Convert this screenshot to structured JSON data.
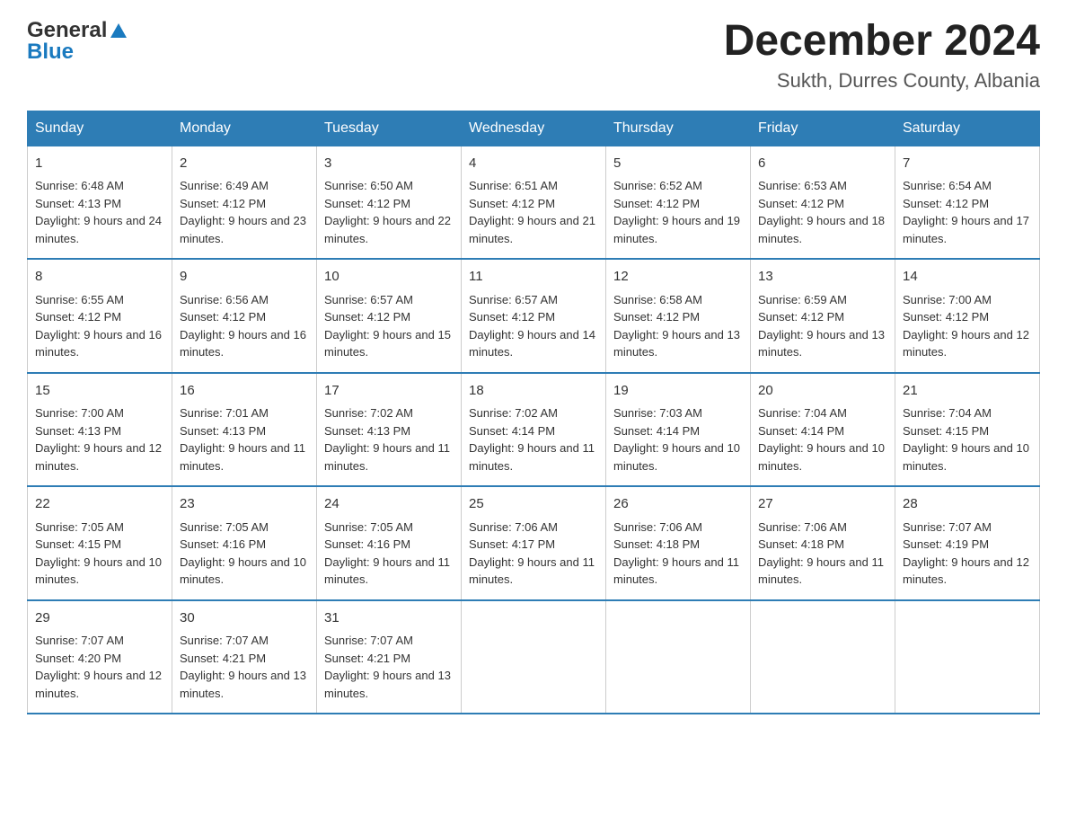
{
  "header": {
    "logo_general": "General",
    "logo_blue": "Blue",
    "month_title": "December 2024",
    "location": "Sukth, Durres County, Albania"
  },
  "weekdays": [
    "Sunday",
    "Monday",
    "Tuesday",
    "Wednesday",
    "Thursday",
    "Friday",
    "Saturday"
  ],
  "weeks": [
    [
      {
        "day": "1",
        "sunrise": "Sunrise: 6:48 AM",
        "sunset": "Sunset: 4:13 PM",
        "daylight": "Daylight: 9 hours and 24 minutes."
      },
      {
        "day": "2",
        "sunrise": "Sunrise: 6:49 AM",
        "sunset": "Sunset: 4:12 PM",
        "daylight": "Daylight: 9 hours and 23 minutes."
      },
      {
        "day": "3",
        "sunrise": "Sunrise: 6:50 AM",
        "sunset": "Sunset: 4:12 PM",
        "daylight": "Daylight: 9 hours and 22 minutes."
      },
      {
        "day": "4",
        "sunrise": "Sunrise: 6:51 AM",
        "sunset": "Sunset: 4:12 PM",
        "daylight": "Daylight: 9 hours and 21 minutes."
      },
      {
        "day": "5",
        "sunrise": "Sunrise: 6:52 AM",
        "sunset": "Sunset: 4:12 PM",
        "daylight": "Daylight: 9 hours and 19 minutes."
      },
      {
        "day": "6",
        "sunrise": "Sunrise: 6:53 AM",
        "sunset": "Sunset: 4:12 PM",
        "daylight": "Daylight: 9 hours and 18 minutes."
      },
      {
        "day": "7",
        "sunrise": "Sunrise: 6:54 AM",
        "sunset": "Sunset: 4:12 PM",
        "daylight": "Daylight: 9 hours and 17 minutes."
      }
    ],
    [
      {
        "day": "8",
        "sunrise": "Sunrise: 6:55 AM",
        "sunset": "Sunset: 4:12 PM",
        "daylight": "Daylight: 9 hours and 16 minutes."
      },
      {
        "day": "9",
        "sunrise": "Sunrise: 6:56 AM",
        "sunset": "Sunset: 4:12 PM",
        "daylight": "Daylight: 9 hours and 16 minutes."
      },
      {
        "day": "10",
        "sunrise": "Sunrise: 6:57 AM",
        "sunset": "Sunset: 4:12 PM",
        "daylight": "Daylight: 9 hours and 15 minutes."
      },
      {
        "day": "11",
        "sunrise": "Sunrise: 6:57 AM",
        "sunset": "Sunset: 4:12 PM",
        "daylight": "Daylight: 9 hours and 14 minutes."
      },
      {
        "day": "12",
        "sunrise": "Sunrise: 6:58 AM",
        "sunset": "Sunset: 4:12 PM",
        "daylight": "Daylight: 9 hours and 13 minutes."
      },
      {
        "day": "13",
        "sunrise": "Sunrise: 6:59 AM",
        "sunset": "Sunset: 4:12 PM",
        "daylight": "Daylight: 9 hours and 13 minutes."
      },
      {
        "day": "14",
        "sunrise": "Sunrise: 7:00 AM",
        "sunset": "Sunset: 4:12 PM",
        "daylight": "Daylight: 9 hours and 12 minutes."
      }
    ],
    [
      {
        "day": "15",
        "sunrise": "Sunrise: 7:00 AM",
        "sunset": "Sunset: 4:13 PM",
        "daylight": "Daylight: 9 hours and 12 minutes."
      },
      {
        "day": "16",
        "sunrise": "Sunrise: 7:01 AM",
        "sunset": "Sunset: 4:13 PM",
        "daylight": "Daylight: 9 hours and 11 minutes."
      },
      {
        "day": "17",
        "sunrise": "Sunrise: 7:02 AM",
        "sunset": "Sunset: 4:13 PM",
        "daylight": "Daylight: 9 hours and 11 minutes."
      },
      {
        "day": "18",
        "sunrise": "Sunrise: 7:02 AM",
        "sunset": "Sunset: 4:14 PM",
        "daylight": "Daylight: 9 hours and 11 minutes."
      },
      {
        "day": "19",
        "sunrise": "Sunrise: 7:03 AM",
        "sunset": "Sunset: 4:14 PM",
        "daylight": "Daylight: 9 hours and 10 minutes."
      },
      {
        "day": "20",
        "sunrise": "Sunrise: 7:04 AM",
        "sunset": "Sunset: 4:14 PM",
        "daylight": "Daylight: 9 hours and 10 minutes."
      },
      {
        "day": "21",
        "sunrise": "Sunrise: 7:04 AM",
        "sunset": "Sunset: 4:15 PM",
        "daylight": "Daylight: 9 hours and 10 minutes."
      }
    ],
    [
      {
        "day": "22",
        "sunrise": "Sunrise: 7:05 AM",
        "sunset": "Sunset: 4:15 PM",
        "daylight": "Daylight: 9 hours and 10 minutes."
      },
      {
        "day": "23",
        "sunrise": "Sunrise: 7:05 AM",
        "sunset": "Sunset: 4:16 PM",
        "daylight": "Daylight: 9 hours and 10 minutes."
      },
      {
        "day": "24",
        "sunrise": "Sunrise: 7:05 AM",
        "sunset": "Sunset: 4:16 PM",
        "daylight": "Daylight: 9 hours and 11 minutes."
      },
      {
        "day": "25",
        "sunrise": "Sunrise: 7:06 AM",
        "sunset": "Sunset: 4:17 PM",
        "daylight": "Daylight: 9 hours and 11 minutes."
      },
      {
        "day": "26",
        "sunrise": "Sunrise: 7:06 AM",
        "sunset": "Sunset: 4:18 PM",
        "daylight": "Daylight: 9 hours and 11 minutes."
      },
      {
        "day": "27",
        "sunrise": "Sunrise: 7:06 AM",
        "sunset": "Sunset: 4:18 PM",
        "daylight": "Daylight: 9 hours and 11 minutes."
      },
      {
        "day": "28",
        "sunrise": "Sunrise: 7:07 AM",
        "sunset": "Sunset: 4:19 PM",
        "daylight": "Daylight: 9 hours and 12 minutes."
      }
    ],
    [
      {
        "day": "29",
        "sunrise": "Sunrise: 7:07 AM",
        "sunset": "Sunset: 4:20 PM",
        "daylight": "Daylight: 9 hours and 12 minutes."
      },
      {
        "day": "30",
        "sunrise": "Sunrise: 7:07 AM",
        "sunset": "Sunset: 4:21 PM",
        "daylight": "Daylight: 9 hours and 13 minutes."
      },
      {
        "day": "31",
        "sunrise": "Sunrise: 7:07 AM",
        "sunset": "Sunset: 4:21 PM",
        "daylight": "Daylight: 9 hours and 13 minutes."
      },
      {
        "day": "",
        "sunrise": "",
        "sunset": "",
        "daylight": ""
      },
      {
        "day": "",
        "sunrise": "",
        "sunset": "",
        "daylight": ""
      },
      {
        "day": "",
        "sunrise": "",
        "sunset": "",
        "daylight": ""
      },
      {
        "day": "",
        "sunrise": "",
        "sunset": "",
        "daylight": ""
      }
    ]
  ]
}
